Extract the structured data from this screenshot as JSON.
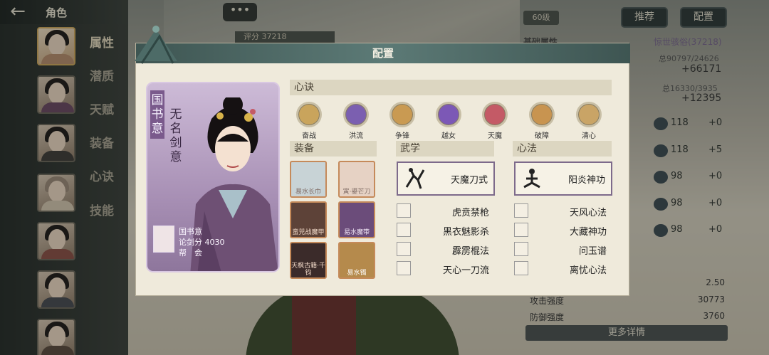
{
  "header": {
    "title": "角色",
    "back_icon": "back-arrow-icon"
  },
  "chat_button": "•••",
  "left_nav": {
    "tabs": [
      "属性",
      "潜质",
      "天赋",
      "装备",
      "心诀",
      "技能"
    ],
    "selected_tab": 0
  },
  "right_panel": {
    "level": "60级",
    "recommend_button": "推荐",
    "config_button": "配置",
    "score": "评分 37218",
    "basic_attr_label": "基础属性",
    "basic_attr_value": "惊世骇俗(37218)",
    "total1": "总90797/24626",
    "delta1": "+66171",
    "total2": "总16330/3935",
    "delta2": "+12395",
    "stats": [
      {
        "value": "118",
        "plus": "+0"
      },
      {
        "value": "118",
        "plus": "+5"
      },
      {
        "value": "98",
        "plus": "+0"
      },
      {
        "value": "98",
        "plus": "+0"
      },
      {
        "value": "98",
        "plus": "+0"
      }
    ],
    "crit_value": "2.50",
    "attack_label": "攻击强度",
    "attack_value": "30773",
    "defense_label": "防御强度",
    "defense_value": "3760",
    "more_details": "更多详情"
  },
  "modal": {
    "title": "配置",
    "card": {
      "name_vertical": "国书意",
      "title_vertical": "无名剑意",
      "info_name": "国书意",
      "info_score": "论剑分 4030",
      "info_guild": "帮　会"
    },
    "xinjue_header": "心诀",
    "xinjue": [
      {
        "label": "奋战",
        "color": "#c9a45c"
      },
      {
        "label": "洪流",
        "color": "#7b5fb0"
      },
      {
        "label": "争锋",
        "color": "#c99a52"
      },
      {
        "label": "越女",
        "color": "#7c58b6"
      },
      {
        "label": "天魔",
        "color": "#c45a66"
      },
      {
        "label": "破障",
        "color": "#c89450"
      },
      {
        "label": "清心",
        "color": "#c9a466"
      }
    ],
    "equip_header": "装备",
    "equipment": [
      {
        "caption": "易水长巾",
        "color": "#c8d3d6"
      },
      {
        "caption": "寅·鎏芒刀",
        "color": "#e6d2c4"
      },
      {
        "caption": "蛮兕战魔甲",
        "color": "#5d4238"
      },
      {
        "caption": "易水魔带",
        "color": "#6b4c7a"
      },
      {
        "caption": "天枫古籍·千钧",
        "color": "#3b2b2a"
      },
      {
        "caption": "易水镯",
        "color": "#b58a4c"
      }
    ],
    "wuxue_header": "武学",
    "wuxue_main": "天魔刀式",
    "wuxue_list": [
      "虎贲禁枪",
      "黑衣魅影杀",
      "霹雳棍法",
      "天心一刀流"
    ],
    "xinfa_header": "心法",
    "xinfa_main": "阳炎神功",
    "xinfa_list": [
      "天风心法",
      "大藏神功",
      "问玉谱",
      "离忧心法"
    ]
  }
}
